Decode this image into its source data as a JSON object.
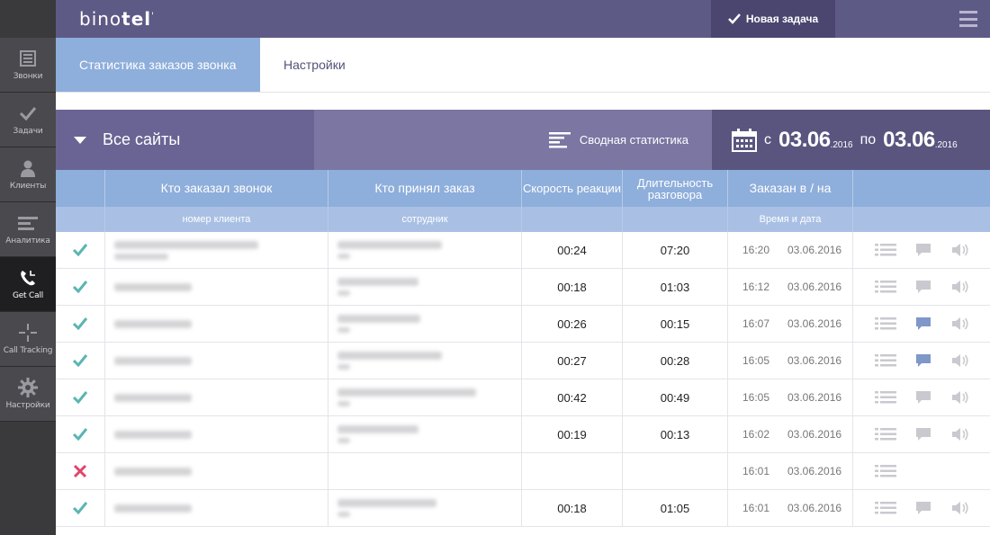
{
  "app": {
    "logo_prefix": "bino",
    "logo_bold": "tel",
    "logo_mark": "'"
  },
  "sidebar": {
    "items": [
      {
        "label": "Звонки",
        "icon": "calls-book-icon",
        "active": false
      },
      {
        "label": "Задачи",
        "icon": "check-icon",
        "active": false
      },
      {
        "label": "Клиенты",
        "icon": "user-icon",
        "active": false
      },
      {
        "label": "Аналитика",
        "icon": "analytics-bars-icon",
        "active": false
      },
      {
        "label": "Get Call",
        "icon": "phone-icon",
        "active": true
      },
      {
        "label": "Call Tracking",
        "icon": "crosshair-icon",
        "active": false
      },
      {
        "label": "Настройки",
        "icon": "gear-icon",
        "active": false
      }
    ]
  },
  "header": {
    "new_task_label": "Новая задача"
  },
  "tabs": [
    {
      "label": "Статистика заказов звонка",
      "active": true
    },
    {
      "label": "Настройки",
      "active": false
    }
  ],
  "filter": {
    "sites_label": "Все сайты",
    "summary_label": "Сводная статистика",
    "from_word": "с",
    "from_date": "03.06",
    "from_year": ".2016",
    "to_word": "по",
    "to_date": "03.06",
    "to_year": ".2016"
  },
  "table": {
    "headers": {
      "who_ordered": "Кто заказал звонок",
      "who_accepted": "Кто принял заказ",
      "speed": "Скорость реакции",
      "duration": "Длительность разговора",
      "ordered_at": "Заказан в / на"
    },
    "subheaders": {
      "client_number": "номер клиента",
      "employee": "сотрудник",
      "time_date": "Время и дата"
    },
    "rows": [
      {
        "status": "ok",
        "speed": "00:24",
        "duration": "07:20",
        "time": "16:20",
        "date": "03.06.2016",
        "comment_active": false,
        "has_audio": true
      },
      {
        "status": "ok",
        "speed": "00:18",
        "duration": "01:03",
        "time": "16:12",
        "date": "03.06.2016",
        "comment_active": false,
        "has_audio": true
      },
      {
        "status": "ok",
        "speed": "00:26",
        "duration": "00:15",
        "time": "16:07",
        "date": "03.06.2016",
        "comment_active": true,
        "has_audio": true
      },
      {
        "status": "ok",
        "speed": "00:27",
        "duration": "00:28",
        "time": "16:05",
        "date": "03.06.2016",
        "comment_active": true,
        "has_audio": true
      },
      {
        "status": "ok",
        "speed": "00:42",
        "duration": "00:49",
        "time": "16:05",
        "date": "03.06.2016",
        "comment_active": false,
        "has_audio": true
      },
      {
        "status": "ok",
        "speed": "00:19",
        "duration": "00:13",
        "time": "16:02",
        "date": "03.06.2016",
        "comment_active": false,
        "has_audio": true
      },
      {
        "status": "missed",
        "speed": "",
        "duration": "",
        "time": "16:01",
        "date": "03.06.2016",
        "comment_active": false,
        "has_audio": false
      },
      {
        "status": "ok",
        "speed": "00:18",
        "duration": "01:05",
        "time": "16:01",
        "date": "03.06.2016",
        "comment_active": false,
        "has_audio": true
      }
    ]
  },
  "colors": {
    "ok": "#5bb5b2",
    "missed": "#e0456c",
    "comment_active": "#7f97c9",
    "icon_muted": "#c9c9cf"
  }
}
